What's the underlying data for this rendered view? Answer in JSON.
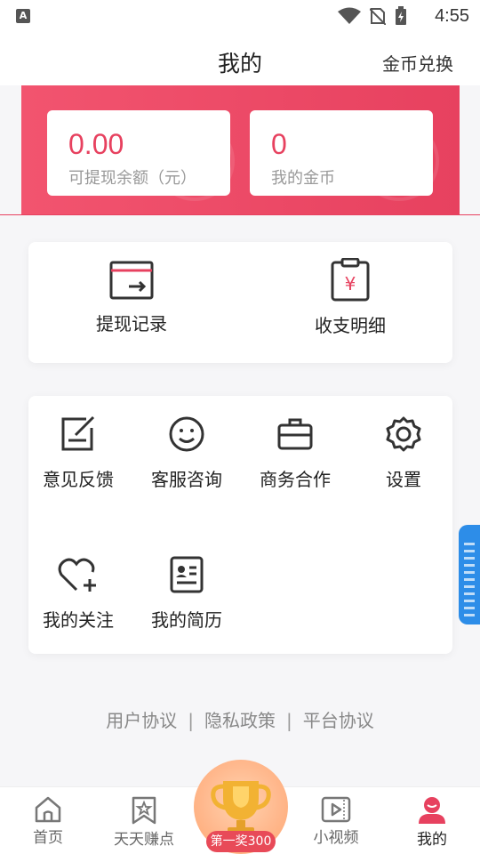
{
  "status_bar": {
    "time": "4:55",
    "notification_icon": "A"
  },
  "header": {
    "title": "我的",
    "exchange_label": "金币兑换"
  },
  "balance": {
    "withdrawable_amount": "0.00",
    "withdrawable_label": "可提现余额（元）",
    "coins_amount": "0",
    "coins_label": "我的金币"
  },
  "records": [
    {
      "label": "提现记录",
      "icon": "withdraw-record-icon"
    },
    {
      "label": "收支明细",
      "icon": "income-detail-icon"
    }
  ],
  "services": [
    {
      "label": "意见反馈",
      "icon": "feedback-icon"
    },
    {
      "label": "客服咨询",
      "icon": "customer-service-icon"
    },
    {
      "label": "商务合作",
      "icon": "briefcase-icon"
    },
    {
      "label": "设置",
      "icon": "gear-icon"
    },
    {
      "label": "我的关注",
      "icon": "heart-plus-icon"
    },
    {
      "label": "我的简历",
      "icon": "resume-icon"
    }
  ],
  "footer_links": {
    "user_agreement": "用户协议",
    "privacy_policy": "隐私政策",
    "platform_agreement": "平台协议",
    "separator": "|"
  },
  "bottom_nav": {
    "home": "首页",
    "earn": "天天赚点",
    "prize": "第一奖300",
    "video": "小视频",
    "mine": "我的"
  },
  "colors": {
    "accent": "#e7415f",
    "side_tab": "#2d8de8"
  }
}
